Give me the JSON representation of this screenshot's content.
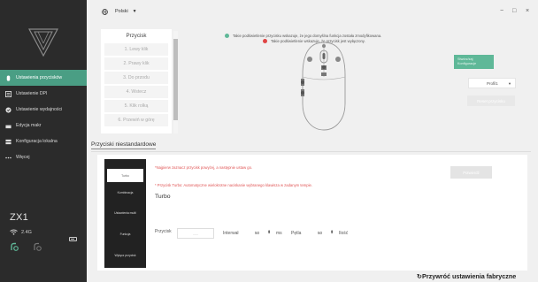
{
  "app": {
    "language": "Polski",
    "window_controls": [
      "−",
      "□",
      "×"
    ]
  },
  "sidebar": {
    "logo_icon": "v-shield-logo",
    "items": [
      {
        "label": "Ustawienia przycisków",
        "icon": "mouse-icon",
        "active": true
      },
      {
        "label": "Ustawienie DPI",
        "icon": "dpi-icon",
        "active": false
      },
      {
        "label": "Ustawienie wydajności",
        "icon": "performance-icon",
        "active": false
      },
      {
        "label": "Edycja makr",
        "icon": "keyboard-icon",
        "active": false
      },
      {
        "label": "Konfiguracja lokalna",
        "icon": "storage-icon",
        "active": false
      },
      {
        "label": "Więcej",
        "icon": "more-icon",
        "active": false
      }
    ],
    "device": {
      "name": "ZX1",
      "connection": "2.4G"
    }
  },
  "buttons_panel": {
    "title": "Przycisk",
    "items": [
      "1. Lewy klik",
      "2. Prawy klik",
      "3. Do przodu",
      "4. Wstecz",
      "5. Klik rolką",
      "6. Przewiń w górę"
    ]
  },
  "legend": {
    "default_text": "Takie podświetlenie przycisku wskazuje, że jego domyślna funkcja została zmodyfikowana.",
    "disabled_text": "Takie podświetlenie wskazuje, że przycisk jest wyłączony.",
    "default_color": "#5fb898",
    "disabled_color": "#e04444"
  },
  "right_controls": {
    "green_button_line1": "Stwórz/zaj",
    "green_button_line2": "Konfiguracje",
    "profile_value": "Profil1",
    "reset_label": "Reset przycisku"
  },
  "nonstandard": {
    "section_title": "Przyciski niestandardowe",
    "items": [
      "Turbo",
      "Kombinacja",
      "Ustawienia multi",
      "Funkcja",
      "Wyłącz przycisk"
    ],
    "active_index": 0,
    "warning_1": "*Najpierw zaznacz przycisk powyżej, a następnie ustaw go.",
    "warning_2": "* Przycisk Turbo: Automatyczne wielokrotne naciskanie wybranego klawisza w zadanym tempie.",
    "turbo_title": "Turbo",
    "confirm_label": "Potwierdź",
    "key_label": "Przycisk",
    "key_placeholder": "......",
    "interval_label": "Interwał",
    "interval_value": "50",
    "interval_unit": "ms",
    "loop_label": "Pętla",
    "loop_value": "50",
    "count_label": "Ilość"
  },
  "footer": {
    "restore_label": "Przywróć ustawienia fabryczne"
  }
}
